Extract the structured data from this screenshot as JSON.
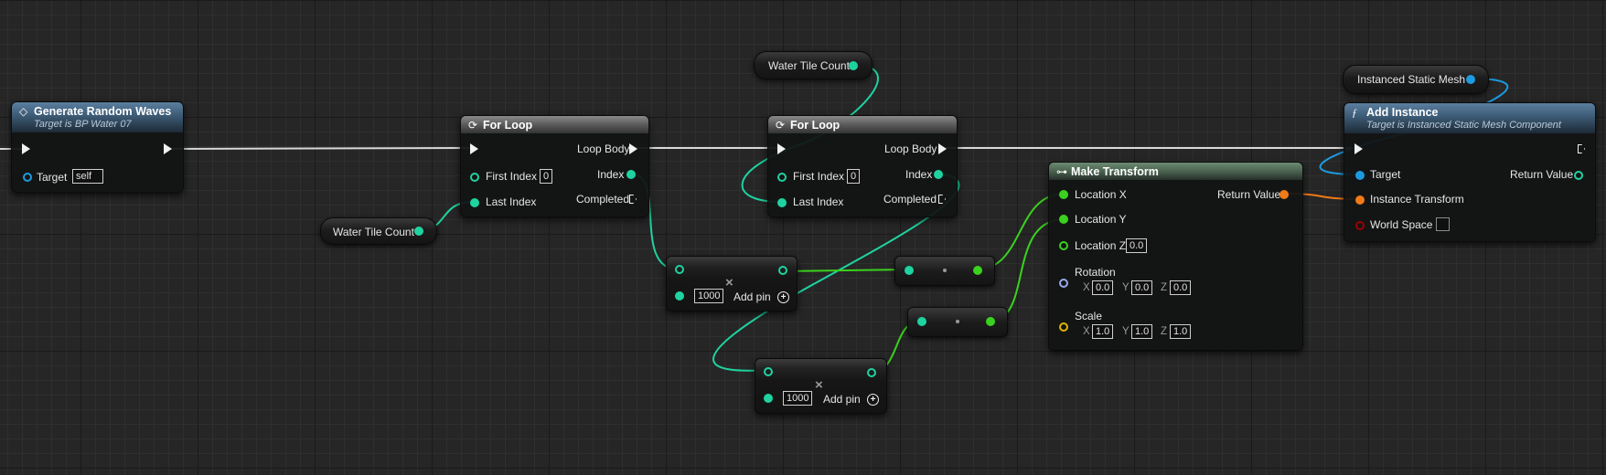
{
  "colors": {
    "exec": "#f2f2f2",
    "integer": "#1fd3a0",
    "float": "#3ad21e",
    "object": "#1d9be0",
    "transform": "#f07a17",
    "vector": "#e1b400",
    "rotator": "#9aa7ee",
    "bool": "#a00000"
  },
  "generate_node": {
    "icon": "event-diamond-icon",
    "title": "Generate Random Waves",
    "subtitle": "Target is BP Water 07",
    "target_label": "Target",
    "target_value": "self"
  },
  "getter_tile_count_a": {
    "label": "Water Tile Count"
  },
  "getter_tile_count_b": {
    "label": "Water Tile Count"
  },
  "getter_ismesh": {
    "label": "Instanced Static Mesh"
  },
  "for_loop_1": {
    "icon": "loop-icon",
    "title": "For Loop",
    "first_index_label": "First Index",
    "first_index_value": "0",
    "last_index_label": "Last Index",
    "loop_body_label": "Loop Body",
    "index_label": "Index",
    "completed_label": "Completed"
  },
  "for_loop_2": {
    "icon": "loop-icon",
    "title": "For Loop",
    "first_index_label": "First Index",
    "first_index_value": "0",
    "last_index_label": "Last Index",
    "loop_body_label": "Loop Body",
    "index_label": "Index",
    "completed_label": "Completed"
  },
  "multiply_1": {
    "value": "1000",
    "add_pin_label": "Add pin"
  },
  "multiply_2": {
    "value": "1000",
    "add_pin_label": "Add pin"
  },
  "make_transform": {
    "icon": "struct-make-icon",
    "title": "Make Transform",
    "location_x_label": "Location X",
    "location_y_label": "Location Y",
    "location_z_label": "Location Z",
    "location_z_value": "0.0",
    "rotation_label": "Rotation",
    "rotation": {
      "x_label": "X",
      "x": "0.0",
      "y_label": "Y",
      "y": "0.0",
      "z_label": "Z",
      "z": "0.0"
    },
    "scale_label": "Scale",
    "scale": {
      "x_label": "X",
      "x": "1.0",
      "y_label": "Y",
      "y": "1.0",
      "z_label": "Z",
      "z": "1.0"
    },
    "return_value_label": "Return Value"
  },
  "add_instance": {
    "icon": "function-icon",
    "icon_glyph": "ƒ",
    "title": "Add Instance",
    "subtitle": "Target is Instanced Static Mesh Component",
    "target_label": "Target",
    "instance_transform_label": "Instance Transform",
    "world_space_label": "World Space",
    "return_value_label": "Return Value"
  }
}
